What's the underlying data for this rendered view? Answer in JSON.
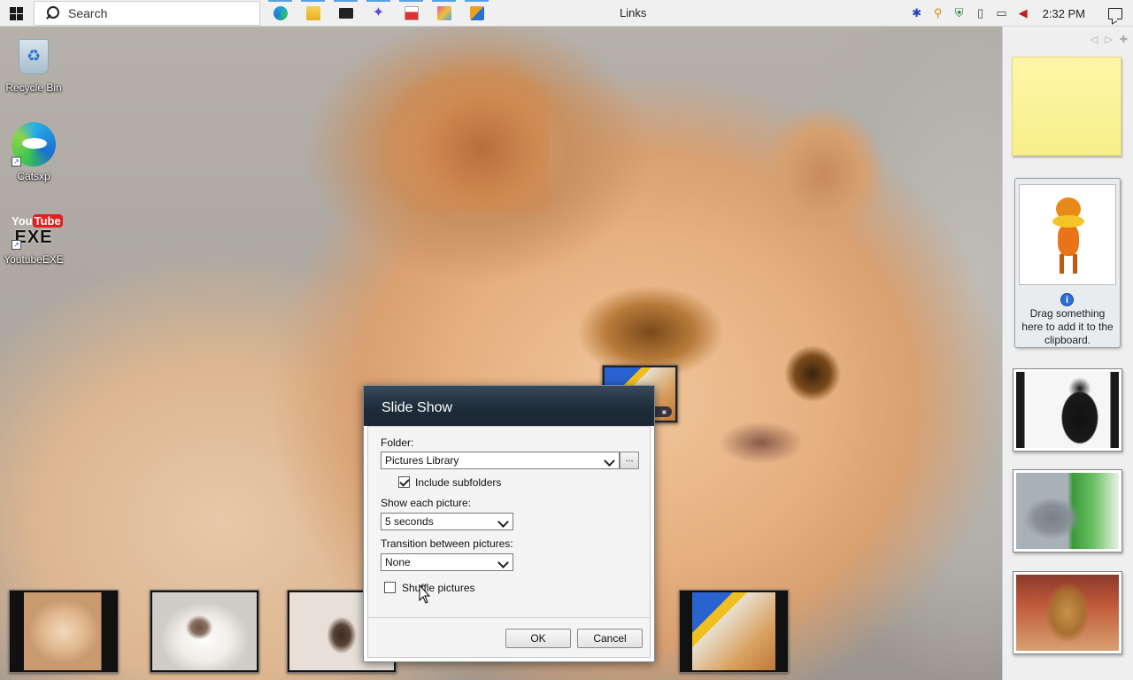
{
  "taskbar": {
    "search_placeholder": "Search",
    "links_label": "Links",
    "clock": "2:32 PM",
    "pinned_icons": [
      "edge-icon",
      "file-explorer-icon",
      "terminal-icon",
      "app-icon",
      "wfexe-icon",
      "paint-icon",
      "media-icon"
    ]
  },
  "desktop": {
    "icons": [
      {
        "label": "Recycle Bin"
      },
      {
        "label": "Catsxp"
      },
      {
        "label": "YoutubeEXE",
        "logo_top": "YouTube",
        "logo_you": "You",
        "logo_tube": "Tube",
        "logo_bottom": "EXE"
      }
    ]
  },
  "sidebar": {
    "clipboard_message": "Drag something here to add it to the clipboard.",
    "clipboard_info": "i"
  },
  "dialog": {
    "title": "Slide Show",
    "folder_label": "Folder:",
    "folder_value": "Pictures Library",
    "browse_label": "...",
    "include_subfolders_label": "Include subfolders",
    "include_subfolders_checked": true,
    "show_each_label": "Show each picture:",
    "show_each_value": "5 seconds",
    "transition_label": "Transition between pictures:",
    "transition_value": "None",
    "shuffle_label": "Shuffle pictures",
    "shuffle_checked": false,
    "ok_label": "OK",
    "cancel_label": "Cancel"
  },
  "colors": {
    "taskbar_bg": "#f0f0f0",
    "dialog_title_bg": "#1e2c3a",
    "sticky_note": "#f8ee8a",
    "accent_underline": "#5aa0e0"
  }
}
